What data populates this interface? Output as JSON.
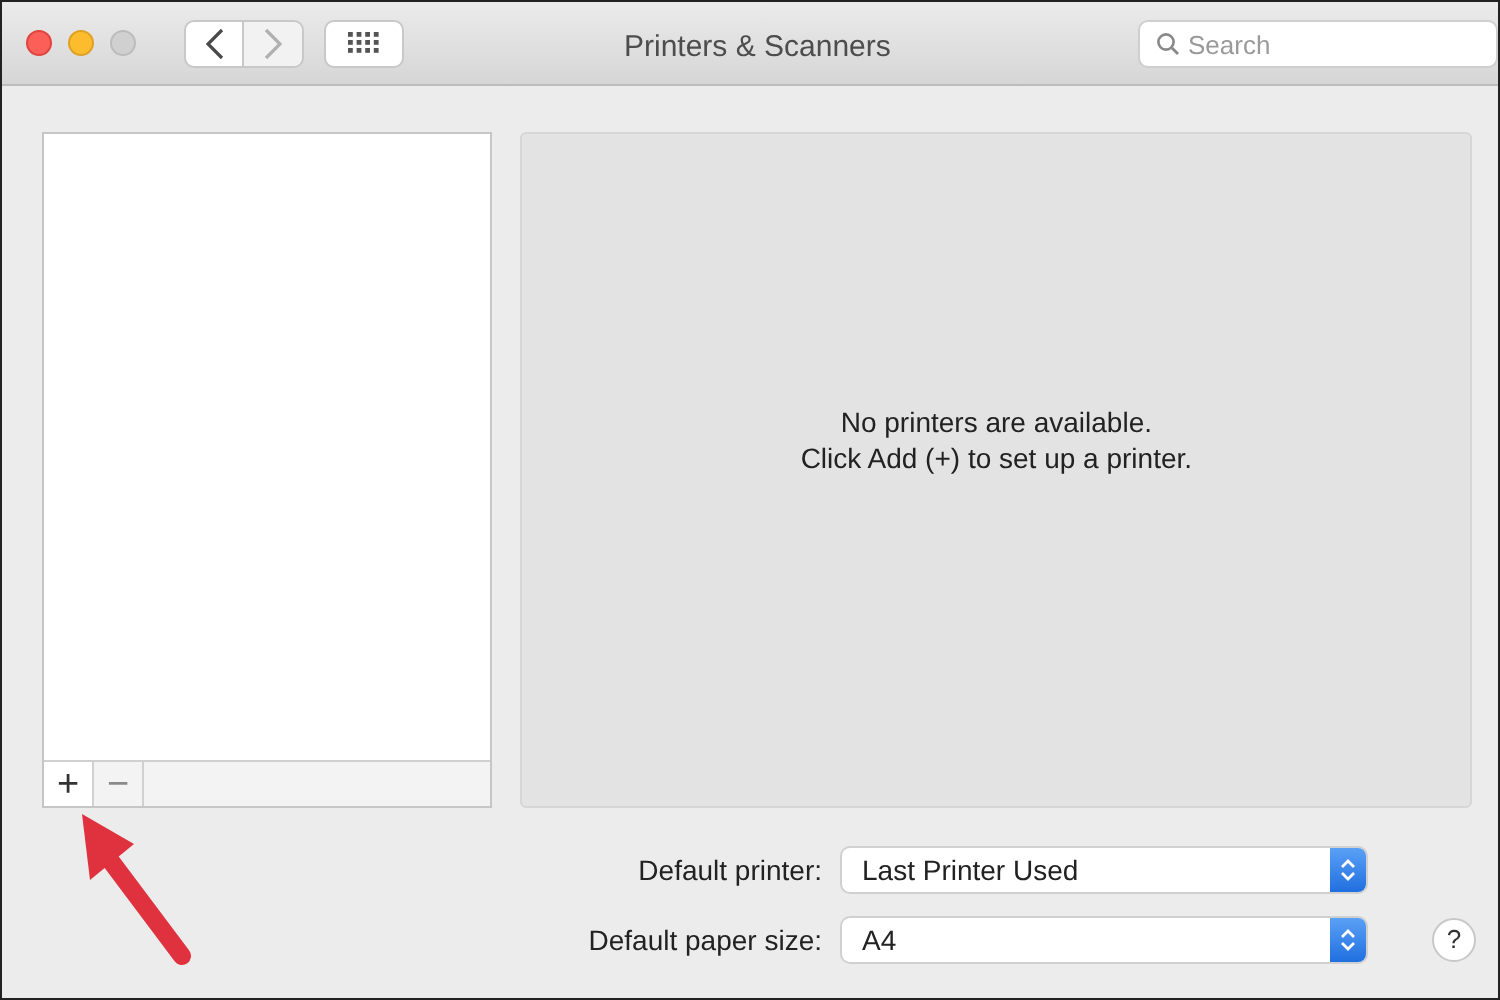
{
  "window": {
    "title": "Printers & Scanners"
  },
  "nav_buttons": [
    {
      "kind": "back",
      "disabled": false
    },
    {
      "kind": "forward",
      "disabled": true
    }
  ],
  "search": {
    "placeholder": "Search"
  },
  "printer_list_buttons": [
    {
      "label": "+",
      "disabled": false
    },
    {
      "label": "−",
      "disabled": true
    }
  ],
  "empty_message": [
    "No printers are available.",
    "Click Add (+) to set up a printer."
  ],
  "settings": [
    {
      "label": "Default printer:",
      "value": "Last Printer Used"
    },
    {
      "label": "Default paper size:",
      "value": "A4"
    }
  ],
  "help_button": "?"
}
